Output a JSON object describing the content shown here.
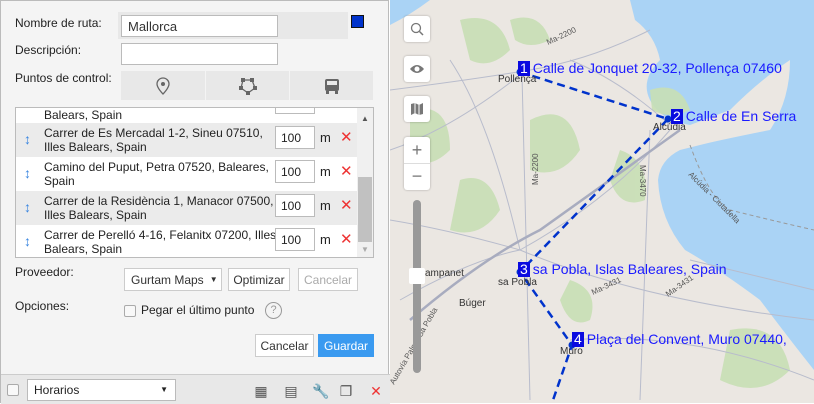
{
  "form": {
    "name_label": "Nombre de ruta:",
    "name_value": "Mallorca",
    "color": "#0033cc",
    "desc_label": "Descripción:",
    "desc_value": "",
    "checkpoints_label": "Puntos de control:",
    "checkpoint_modes": [
      "marker-icon",
      "polygon-icon",
      "bus-icon"
    ],
    "partial_row": "Balears, Spain",
    "points": [
      {
        "address": "Carrer de Es Mercadal 1-2, Sineu 07510, Illes Balears, Spain",
        "radius": "100",
        "unit": "m"
      },
      {
        "address": "Camino del Puput, Petra 07520, Baleares, Spain",
        "radius": "100",
        "unit": "m"
      },
      {
        "address": "Carrer de la Residència 1, Manacor 07500, Illes Balears, Spain",
        "radius": "100",
        "unit": "m"
      },
      {
        "address": "Carrer de Perelló 4-16, Felanitx 07200, Illes Balears, Spain",
        "radius": "100",
        "unit": "m"
      }
    ],
    "provider_label": "Proveedor:",
    "provider_value": "Gurtam Maps",
    "optimize": "Optimizar",
    "cancel_opt": "Cancelar",
    "options_label": "Opciones:",
    "stick_last": "Pegar el último punto",
    "help": "?",
    "cancel": "Cancelar",
    "save": "Guardar"
  },
  "bottom": {
    "schedule_value": "Horarios"
  },
  "map": {
    "markers": [
      {
        "n": "1",
        "label": "Calle de Jonquet 20-32, Pollença 07460"
      },
      {
        "n": "2",
        "label": "Calle de En Serra"
      },
      {
        "n": "3",
        "label": "sa Pobla, Islas Baleares, Spain"
      },
      {
        "n": "4",
        "label": "Plaça del Convent, Muro 07440,"
      }
    ],
    "places": [
      "Pollença",
      "Alcúdia",
      "ampanet",
      "sa Pobla",
      "Búger",
      "Muro"
    ],
    "roads": [
      "Ma-2200",
      "Ma-2200",
      "Ma-3470",
      "Ma-3431",
      "Ma-3431",
      "Alcúdia - Ciutadella",
      "Autovía Palma-Sa Pobla"
    ],
    "route_color": "#0033cc"
  }
}
